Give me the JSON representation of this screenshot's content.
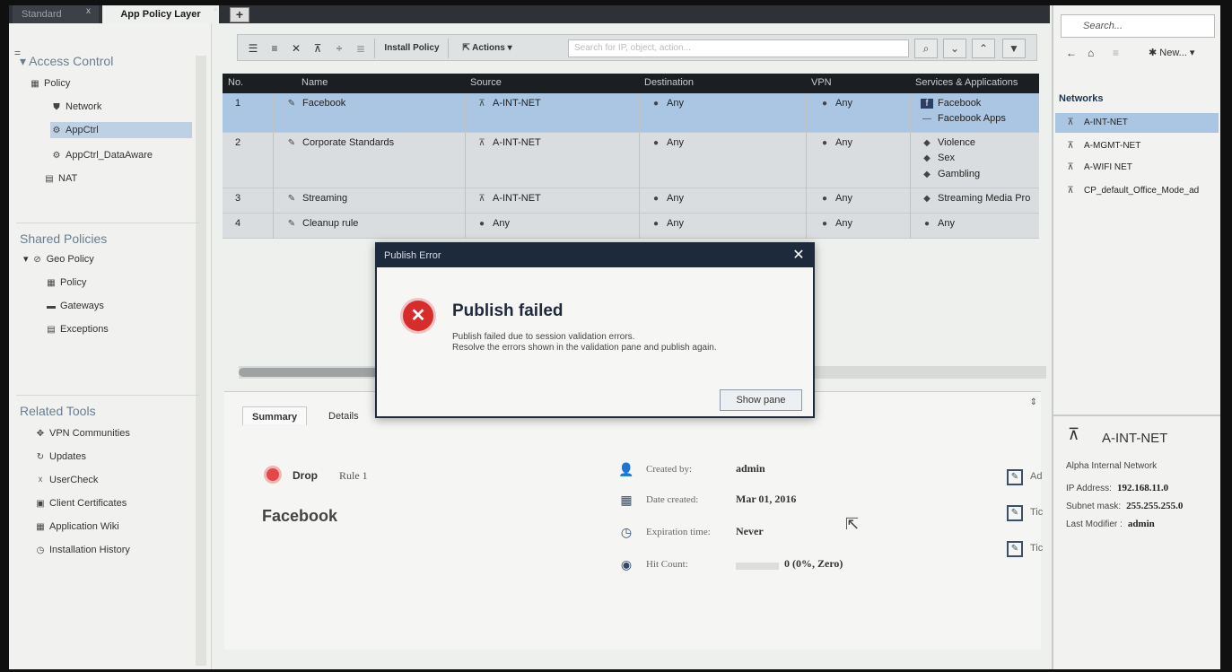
{
  "tabs": {
    "inactive": "Standard",
    "active": "App Policy Layer",
    "plus": "+",
    "modified_mark": "*",
    "close": "x"
  },
  "leftnav": {
    "hamburger": "=",
    "access_control": "Access Control",
    "items": {
      "policy": "Policy",
      "network": "Network",
      "appctrl": "AppCtrl",
      "appctrl_dataaware": "AppCtrl_DataAware",
      "nat": "NAT"
    },
    "shared_policies": "Shared Policies",
    "shared_items": {
      "geo_policy": "Geo Policy",
      "policy": "Policy",
      "gateways": "Gateways",
      "exceptions": "Exceptions"
    },
    "related_tools": "Related Tools",
    "tools": {
      "vpn": "VPN Communities",
      "updates": "Updates",
      "usercheck": "UserCheck",
      "client_certs": "Client Certificates",
      "app_wiki": "Application Wiki",
      "install_history": "Installation History"
    }
  },
  "toolbar": {
    "install_policy": "Install Policy",
    "actions": "Actions",
    "search_placeholder": "Search for IP, object, action..."
  },
  "grid": {
    "columns": [
      "No.",
      "Name",
      "Source",
      "Destination",
      "VPN",
      "Services & Applications"
    ],
    "rows": [
      {
        "no": "1",
        "name": "Facebook",
        "source": "A-INT-NET",
        "destination": "Any",
        "vpn": "Any",
        "services": [
          "Facebook",
          "Facebook Apps"
        ]
      },
      {
        "no": "2",
        "name": "Corporate Standards",
        "source": "A-INT-NET",
        "destination": "Any",
        "vpn": "Any",
        "services": [
          "Violence",
          "Sex",
          "Gambling"
        ]
      },
      {
        "no": "3",
        "name": "Streaming",
        "source": "A-INT-NET",
        "destination": "Any",
        "vpn": "Any",
        "services": [
          "Streaming Media Pro"
        ]
      },
      {
        "no": "4",
        "name": "Cleanup rule",
        "source": "Any",
        "destination": "Any",
        "vpn": "Any",
        "services": [
          "Any"
        ]
      }
    ]
  },
  "bottom": {
    "tabs": [
      "Summary",
      "Details"
    ],
    "action": "Drop",
    "rule": "Rule 1",
    "rule_name": "Facebook",
    "created_by_label": "Created by:",
    "created_by": "admin",
    "date_created_label": "Date created:",
    "date_created": "Mar 01, 2016",
    "expiration_label": "Expiration time:",
    "expiration": "Never",
    "hit_count_label": "Hit Count:",
    "hit_count": "0 (0%, Zero)",
    "side_labels": [
      "Ad",
      "Tic",
      "Tic"
    ]
  },
  "right": {
    "search_placeholder": "Search...",
    "new_label": "New...",
    "networks_title": "Networks",
    "networks": [
      "A-INT-NET",
      "A-MGMT-NET",
      "A-WIFI NET",
      "CP_default_Office_Mode_ad"
    ],
    "object_name": "A-INT-NET",
    "object_desc": "Alpha Internal Network",
    "ip_label": "IP Address:",
    "ip": "192.168.11.0",
    "mask_label": "Subnet mask:",
    "mask": "255.255.255.0",
    "modifier_label": "Last Modifier :",
    "modifier": "admin"
  },
  "modal": {
    "title": "Publish Error",
    "heading": "Publish failed",
    "line1": "Publish failed due to session validation errors.",
    "line2": "Resolve the errors shown in the validation pane and publish again.",
    "button": "Show pane"
  },
  "colors": {
    "selection": "#aac6e2",
    "header_dark": "#1c1f22",
    "error_red": "#d62c2c",
    "modal_title_bg": "#1d2a3c"
  }
}
